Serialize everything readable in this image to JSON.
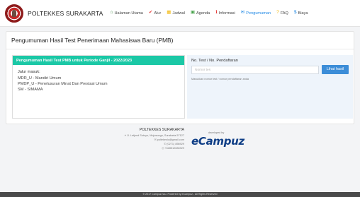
{
  "header": {
    "brand": "POLTEKKES SURAKARTA",
    "nav": [
      {
        "label": "Halaman Utama",
        "icon": "home-icon",
        "glyph": "⌂",
        "color": "#2e7d32"
      },
      {
        "label": "Alur",
        "icon": "check-icon",
        "glyph": "✔",
        "color": "#e53935"
      },
      {
        "label": "Jadwal",
        "icon": "calendar-icon",
        "glyph": "▦",
        "color": "#f2b705"
      },
      {
        "label": "Agenda",
        "icon": "agenda-icon",
        "glyph": "▣",
        "color": "#43a047"
      },
      {
        "label": "Informasi",
        "icon": "info-icon",
        "glyph": "ℹ",
        "color": "#e53935"
      },
      {
        "label": "Pengumuman",
        "icon": "megaphone-icon",
        "glyph": "✉",
        "color": "#1e88e5"
      },
      {
        "label": "FAQ",
        "icon": "question-icon",
        "glyph": "?",
        "color": "#f2b705"
      },
      {
        "label": "Biaya",
        "icon": "dollar-icon",
        "glyph": "$",
        "color": "#1e88e5"
      }
    ],
    "active_index": 5
  },
  "main": {
    "title": "Pengumuman Hasil Test Penerimaan Mahasiswa Baru (PMB)",
    "period_heading": "Pengumuman Hasil Test PMB untuk Periode Ganjil - 2022/2023",
    "jalur_label": "Jalur masuk:",
    "jalur_items": [
      "MDR_U - Mandiri Umum",
      "PMDP_U - Penelusuran Minat Dan Prestasi Umum",
      "SM - SIMAMA"
    ],
    "search": {
      "label": "No. Test / No. Pendaftaran",
      "placeholder": "Nomor tes",
      "button": "Lihat hasil",
      "hint": "Masukkan nomor test / nomor pendaftaran anda"
    }
  },
  "footer": {
    "institution": "POLTEKKES SURAKARTA",
    "address": "Jl. Letjend Sutoyo, Mojosongo, Surakarta 57127",
    "email": "poltekeslo@gmail.com",
    "phone": "(0271) 856929",
    "wa": "+628512636929",
    "developed_by": "developed by",
    "dev_logo": "eCampuz",
    "copyright": "© 2017 Campuz.hou. Powered by eCampuz - All Rights Reserved"
  }
}
